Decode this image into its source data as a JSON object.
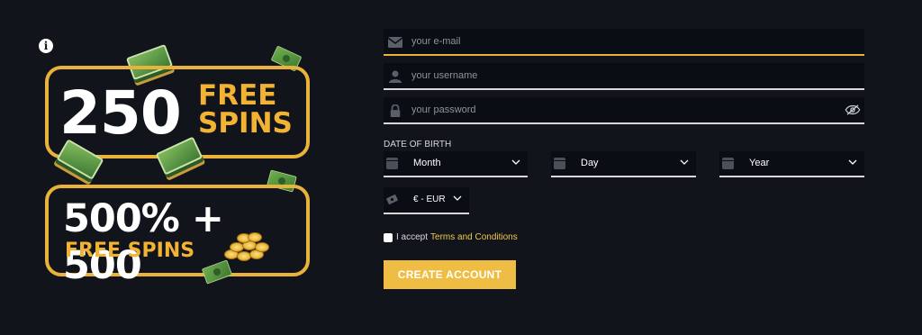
{
  "promo": {
    "spins_count": "250",
    "spins_label": "FREE SPINS",
    "bonus_headline": "500% + 500",
    "bonus_spins_label": "FREE SPINS"
  },
  "form": {
    "email_placeholder": "your e-mail",
    "username_placeholder": "your username",
    "password_placeholder": "your password",
    "dob_label": "DATE OF BIRTH",
    "month_label": "Month",
    "day_label": "Day",
    "year_label": "Year",
    "currency_label": "€ - EUR",
    "accept_text": "I accept",
    "terms_link": "Terms and Conditions",
    "create_account_label": "CREATE ACCOUNT"
  },
  "colors": {
    "background": "#11141b",
    "accent": "#efbd44",
    "field_bg": "#0a0d13"
  },
  "icons": [
    "info-icon",
    "envelope-icon",
    "user-icon",
    "lock-icon",
    "eye-slash-icon",
    "calendar-icon",
    "chevron-down-icon",
    "money-icon"
  ]
}
